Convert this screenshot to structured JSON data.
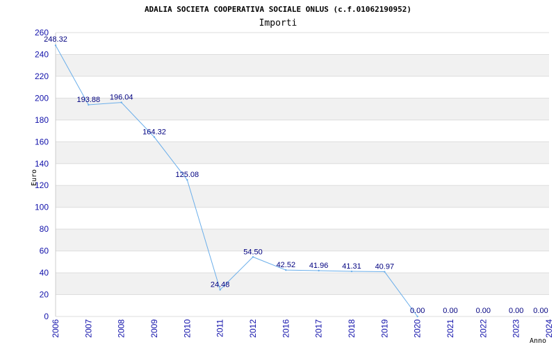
{
  "chart_data": {
    "type": "line",
    "title": "ADALIA SOCIETA COOPERATIVA SOCIALE ONLUS (c.f.01062190952)",
    "subtitle": "Importi",
    "xlabel": "Anno",
    "ylabel": "Euro",
    "categories": [
      "2006",
      "2007",
      "2008",
      "2009",
      "2010",
      "2011",
      "2012",
      "2016",
      "2017",
      "2018",
      "2019",
      "2020",
      "2021",
      "2022",
      "2023",
      "2024"
    ],
    "series": [
      {
        "values": [
          248.32,
          193.88,
          196.04,
          164.32,
          125.08,
          24.48,
          54.5,
          42.52,
          41.96,
          41.31,
          40.97,
          0.0,
          null,
          null,
          null,
          null
        ]
      }
    ],
    "data_labels": [
      "248.32",
      "193.88",
      "196.04",
      "164.32",
      "125.08",
      "24.48",
      "54.50",
      "42.52",
      "41.96",
      "41.31",
      "40.97",
      "0.00",
      "0.00",
      "0.00",
      "0.00",
      "0.00"
    ],
    "ylim": [
      0,
      260
    ],
    "yticks": [
      0,
      20,
      40,
      60,
      80,
      100,
      120,
      140,
      160,
      180,
      200,
      220,
      240,
      260
    ],
    "grid": "horizontal bands",
    "colors": {
      "line": "#6aaeea",
      "band": "#f1f1f1",
      "grid": "#dddddd",
      "tick_text": "#1010aa",
      "label_text": "#000080"
    }
  }
}
